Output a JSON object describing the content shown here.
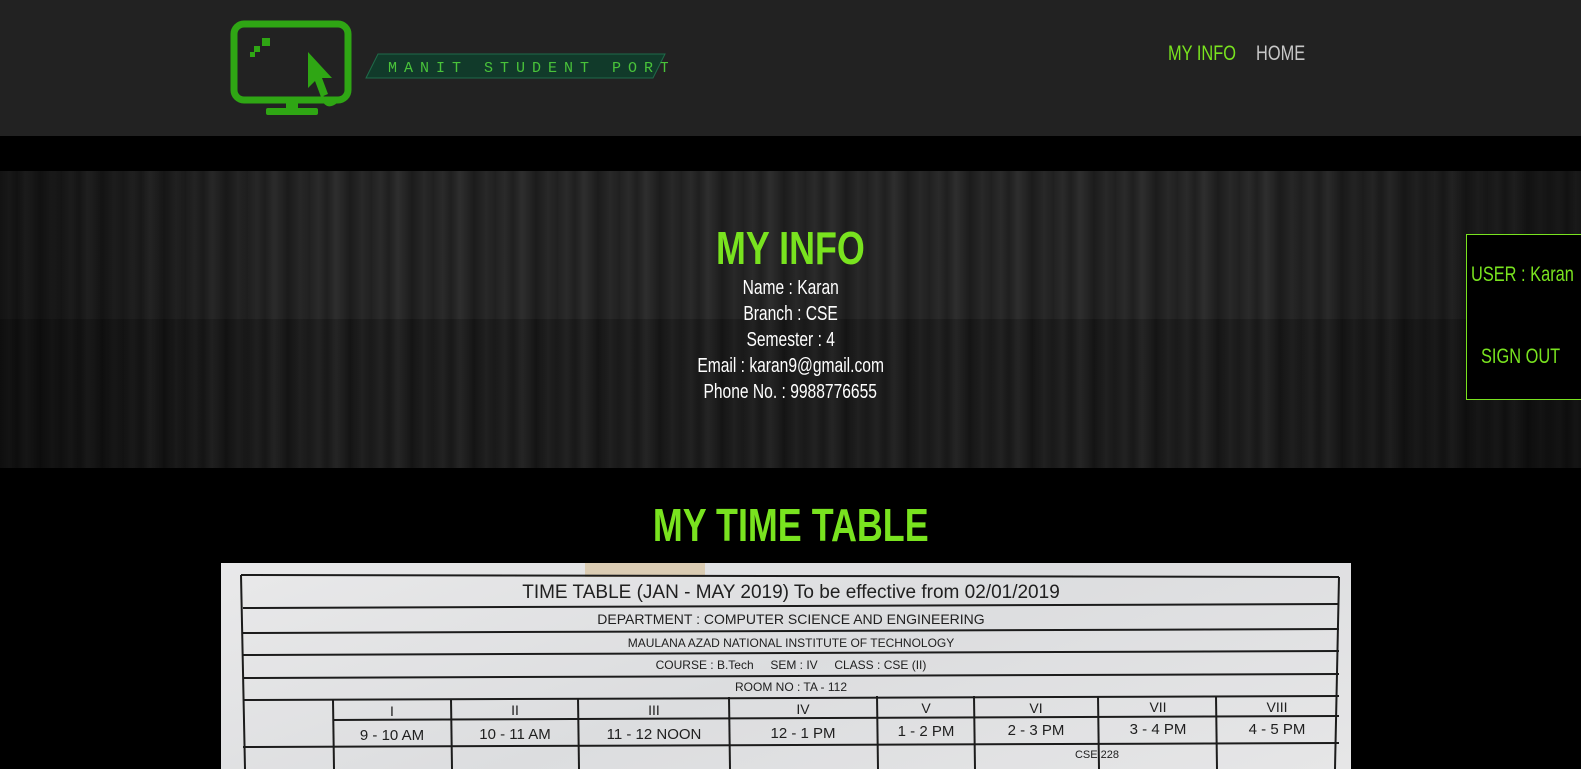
{
  "header": {
    "logo_text": "MANIT STUDENT PORTAL",
    "nav": {
      "my_info": "MY INFO",
      "home": "HOME"
    }
  },
  "info": {
    "title": "MY INFO",
    "lines": [
      "Name : Karan",
      "Branch : CSE",
      "Semester : 4",
      "Email : karan9@gmail.com",
      "Phone No. : 9988776655"
    ]
  },
  "user_box": {
    "user": "USER : Karan",
    "signout": "SIGN OUT"
  },
  "timetable": {
    "title": "MY TIME TABLE",
    "image": {
      "heading": "TIME TABLE (JAN - MAY 2019) To be effective from 02/01/2019",
      "department": "DEPARTMENT : COMPUTER SCIENCE AND ENGINEERING",
      "institute": "MAULANA AZAD NATIONAL INSTITUTE OF TECHNOLOGY",
      "course": "COURSE : B.Tech     SEM : IV     CLASS : CSE (II)",
      "room": "ROOM NO : TA - 112",
      "periods": [
        "I",
        "II",
        "III",
        "IV",
        "V",
        "VI",
        "VII",
        "VIII"
      ],
      "times": [
        "9 - 10 AM",
        "10 - 11 AM",
        "11 - 12 NOON",
        "12 - 1 PM",
        "1 - 2 PM",
        "2 - 3 PM",
        "3 - 4 PM",
        "4 - 5 PM"
      ],
      "cell_note": "CSE 228"
    }
  },
  "colors": {
    "accent": "#79e31f",
    "header_bg": "#222222",
    "page_bg": "#000000"
  }
}
